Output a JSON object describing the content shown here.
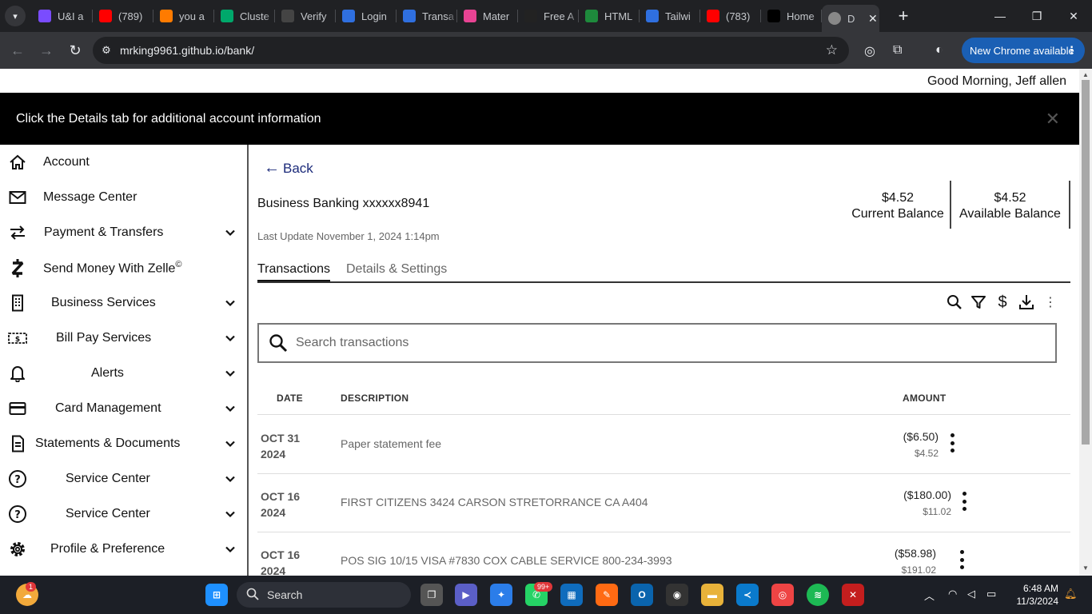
{
  "browser": {
    "tabs": [
      {
        "title": "U&I a",
        "color": "#7a4cff"
      },
      {
        "title": "(789)",
        "color": "#ff0000"
      },
      {
        "title": "you a",
        "color": "#ff7b00"
      },
      {
        "title": "Cluste",
        "color": "#00a86b"
      },
      {
        "title": "Verify",
        "color": "#444444"
      },
      {
        "title": "Login",
        "color": "#2f6fdf"
      },
      {
        "title": "Transa",
        "color": "#2f6fdf"
      },
      {
        "title": "Mater",
        "color": "#e84393"
      },
      {
        "title": "Free A",
        "color": "#222222"
      },
      {
        "title": "HTML",
        "color": "#1e8a3c"
      },
      {
        "title": "Tailwi",
        "color": "#2f6fdf"
      },
      {
        "title": "(783)",
        "color": "#ff0000"
      },
      {
        "title": "Home",
        "color": "#000000"
      }
    ],
    "active_tab": {
      "title": "D"
    },
    "url": "mrking9961.github.io/bank/",
    "update_button": "New Chrome available"
  },
  "header": {
    "greeting": "Good Morning, Jeff allen"
  },
  "banner": {
    "message": "Click the Details tab for additional account information"
  },
  "sidebar": {
    "items": [
      {
        "label": "Account",
        "icon": "home-icon"
      },
      {
        "label": "Message Center",
        "icon": "mail-icon"
      },
      {
        "label": "Payment & Transfers",
        "icon": "transfer-arrows-icon"
      },
      {
        "label": "Send Money With Zelle",
        "icon": "zelle-icon",
        "suffix": "©"
      },
      {
        "label": "Business Services",
        "icon": "building-icon"
      },
      {
        "label": "Bill Pay Services",
        "icon": "bill-icon"
      },
      {
        "label": "Alerts",
        "icon": "bell-icon"
      },
      {
        "label": "Card Management",
        "icon": "credit-card-icon"
      },
      {
        "label": "Statements & Documents",
        "icon": "document-icon"
      },
      {
        "label": "Service Center",
        "icon": "help-circle-icon"
      },
      {
        "label": "Service Center",
        "icon": "help-circle-icon"
      },
      {
        "label": "Profile & Preference",
        "icon": "gear-icon"
      }
    ]
  },
  "account": {
    "back_label": "Back",
    "name": "Business Banking xxxxxx8941",
    "last_update": "Last Update November 1, 2024 1:14pm",
    "current_balance": "$4.52",
    "current_balance_label": "Current Balance",
    "available_balance": "$4.52",
    "available_balance_label": "Available Balance"
  },
  "tabs": {
    "transactions": "Transactions",
    "details": "Details & Settings"
  },
  "search": {
    "placeholder": "Search transactions"
  },
  "table": {
    "headers": {
      "date": "DATE",
      "description": "DESCRIPTION",
      "amount": "AMOUNT"
    },
    "rows": [
      {
        "date_line1": "OCT 31",
        "date_line2": "2024",
        "description": "Paper statement fee",
        "amount": "($6.50)",
        "balance": "$4.52"
      },
      {
        "date_line1": "OCT 16",
        "date_line2": "2024",
        "description": "FIRST CITIZENS 3424 CARSON STRETORRANCE CA A404",
        "amount": "($180.00)",
        "balance": "$11.02"
      },
      {
        "date_line1": "OCT 16",
        "date_line2": "2024",
        "description": "POS SIG 10/15 VISA #7830 COX CABLE SERVICE 800-234-3993",
        "amount": "($58.98)",
        "balance": "$191.02"
      }
    ]
  },
  "taskbar": {
    "search_label": "Search",
    "time": "6:48 AM",
    "date": "11/3/2024",
    "whatsapp_badge": "99+",
    "weather_badge": "1"
  }
}
